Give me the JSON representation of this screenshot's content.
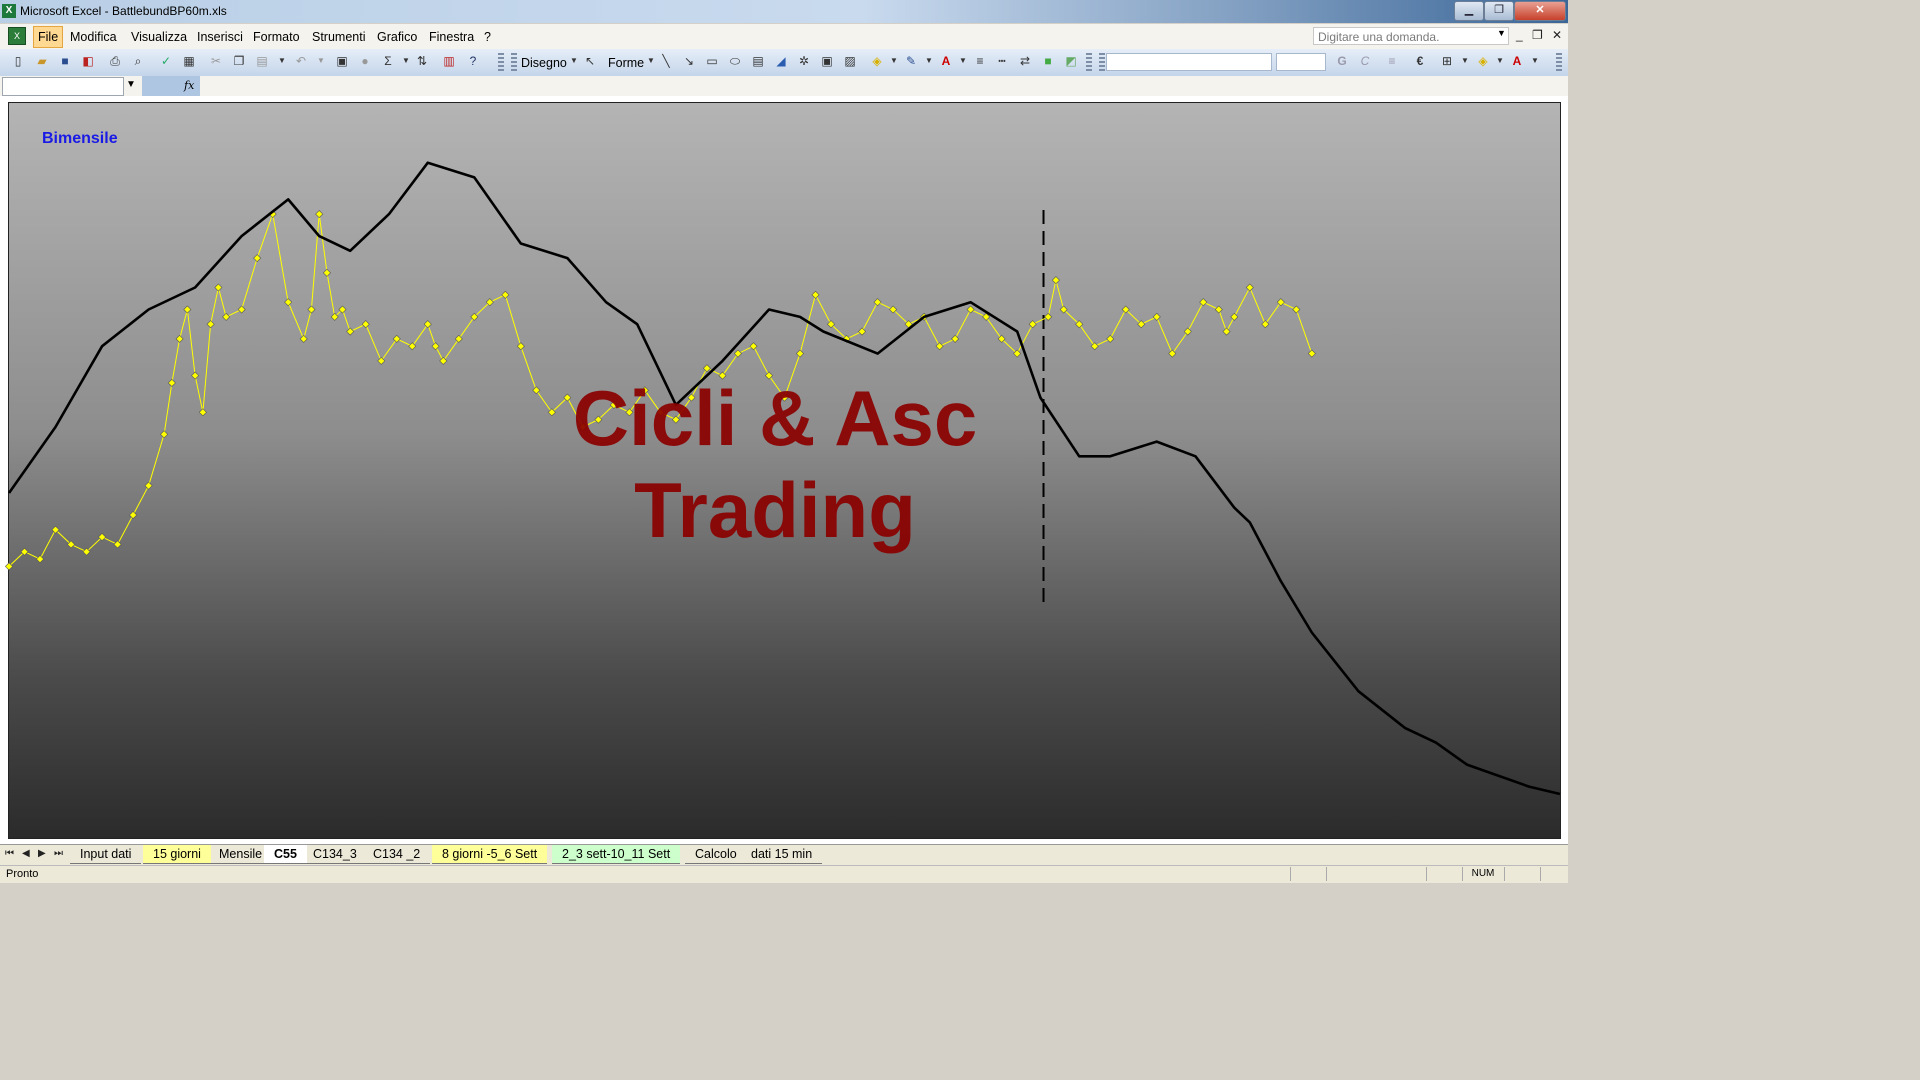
{
  "window": {
    "title": "Microsoft Excel - BattlebundBP60m.xls"
  },
  "menu": {
    "items": [
      "File",
      "Modifica",
      "Visualizza",
      "Inserisci",
      "Formato",
      "Strumenti",
      "Grafico",
      "Finestra",
      "?"
    ],
    "help_placeholder": "Digitare una domanda."
  },
  "toolbar": {
    "drawing_label": "Disegno",
    "shapes_label": "Forme",
    "bold": "G",
    "italic": "C",
    "currency": "€"
  },
  "chart": {
    "label": "Bimensile",
    "watermark": "Cicli & Asc\nTrading",
    "line_color": "#000000",
    "marker_color": "#ffff00",
    "background": "gradient-grey-to-dark"
  },
  "chart_data": {
    "type": "line",
    "title": "",
    "xlabel": "",
    "ylabel": "",
    "grid": false,
    "xlim": [
      0,
      1000
    ],
    "ylim": [
      0,
      100
    ],
    "series": [
      {
        "style": "black-curve",
        "x": [
          0,
          30,
          60,
          90,
          120,
          150,
          180,
          200,
          220,
          245,
          270,
          300,
          330,
          360,
          385,
          405,
          430,
          460,
          490,
          510,
          525,
          560,
          590,
          620,
          650,
          665,
          690,
          710,
          740,
          765,
          790,
          800,
          820,
          840,
          870,
          900,
          920,
          940,
          980,
          1000
        ],
        "y": [
          47,
          56,
          67,
          72,
          75,
          82,
          87,
          82,
          80,
          85,
          92,
          90,
          81,
          79,
          73,
          70,
          59,
          65,
          72,
          71,
          69,
          66,
          71,
          73,
          69,
          60,
          52,
          52,
          54,
          52,
          45,
          43,
          35,
          28,
          20,
          15,
          13,
          10,
          7,
          6
        ]
      },
      {
        "style": "yellow-diamond-markers",
        "x": [
          0,
          10,
          20,
          30,
          40,
          50,
          60,
          70,
          80,
          90,
          100,
          105,
          110,
          115,
          120,
          125,
          130,
          135,
          140,
          150,
          160,
          170,
          180,
          190,
          195,
          200,
          205,
          210,
          215,
          220,
          230,
          240,
          250,
          260,
          270,
          275,
          280,
          290,
          300,
          310,
          320,
          330,
          340,
          350,
          360,
          370,
          380,
          390,
          400,
          410,
          420,
          430,
          440,
          450,
          460,
          470,
          480,
          490,
          500,
          510,
          520,
          530,
          540,
          550,
          560,
          570,
          580,
          590,
          600,
          610,
          620,
          630,
          640,
          650,
          660,
          670,
          675,
          680,
          690,
          700,
          710,
          720,
          730,
          740,
          750,
          760,
          770,
          780,
          785,
          790,
          800,
          810,
          820,
          830,
          840
        ],
        "y": [
          37,
          39,
          38,
          42,
          40,
          39,
          41,
          40,
          44,
          48,
          55,
          62,
          68,
          72,
          63,
          58,
          70,
          75,
          71,
          72,
          79,
          85,
          73,
          68,
          72,
          85,
          77,
          71,
          72,
          69,
          70,
          65,
          68,
          67,
          70,
          67,
          65,
          68,
          71,
          73,
          74,
          67,
          61,
          58,
          60,
          56,
          57,
          59,
          58,
          61,
          58,
          57,
          60,
          64,
          63,
          66,
          67,
          63,
          60,
          66,
          74,
          70,
          68,
          69,
          73,
          72,
          70,
          71,
          67,
          68,
          72,
          71,
          68,
          66,
          70,
          71,
          76,
          72,
          70,
          67,
          68,
          72,
          70,
          71,
          66,
          69,
          73,
          72,
          69,
          71,
          75,
          70,
          73,
          72,
          66
        ]
      }
    ],
    "annotations": [
      {
        "type": "vertical-dashed-line",
        "x": 667
      }
    ]
  },
  "sheet_tabs": [
    {
      "label": "Input dati",
      "color": "none"
    },
    {
      "label": "15 giorni",
      "color": "yellow"
    },
    {
      "label": "Mensile",
      "color": "none"
    },
    {
      "label": "C55",
      "color": "active"
    },
    {
      "label": "C134_3",
      "color": "none"
    },
    {
      "label": "C134 _2",
      "color": "none"
    },
    {
      "label": "8 giorni -5_6 Sett",
      "color": "yellow"
    },
    {
      "label": "2_3 sett-10_11 Sett",
      "color": "green"
    },
    {
      "label": "Calcolo",
      "color": "none"
    },
    {
      "label": "dati 15 min",
      "color": "none"
    }
  ],
  "status": {
    "text": "Pronto",
    "num": "NUM"
  }
}
